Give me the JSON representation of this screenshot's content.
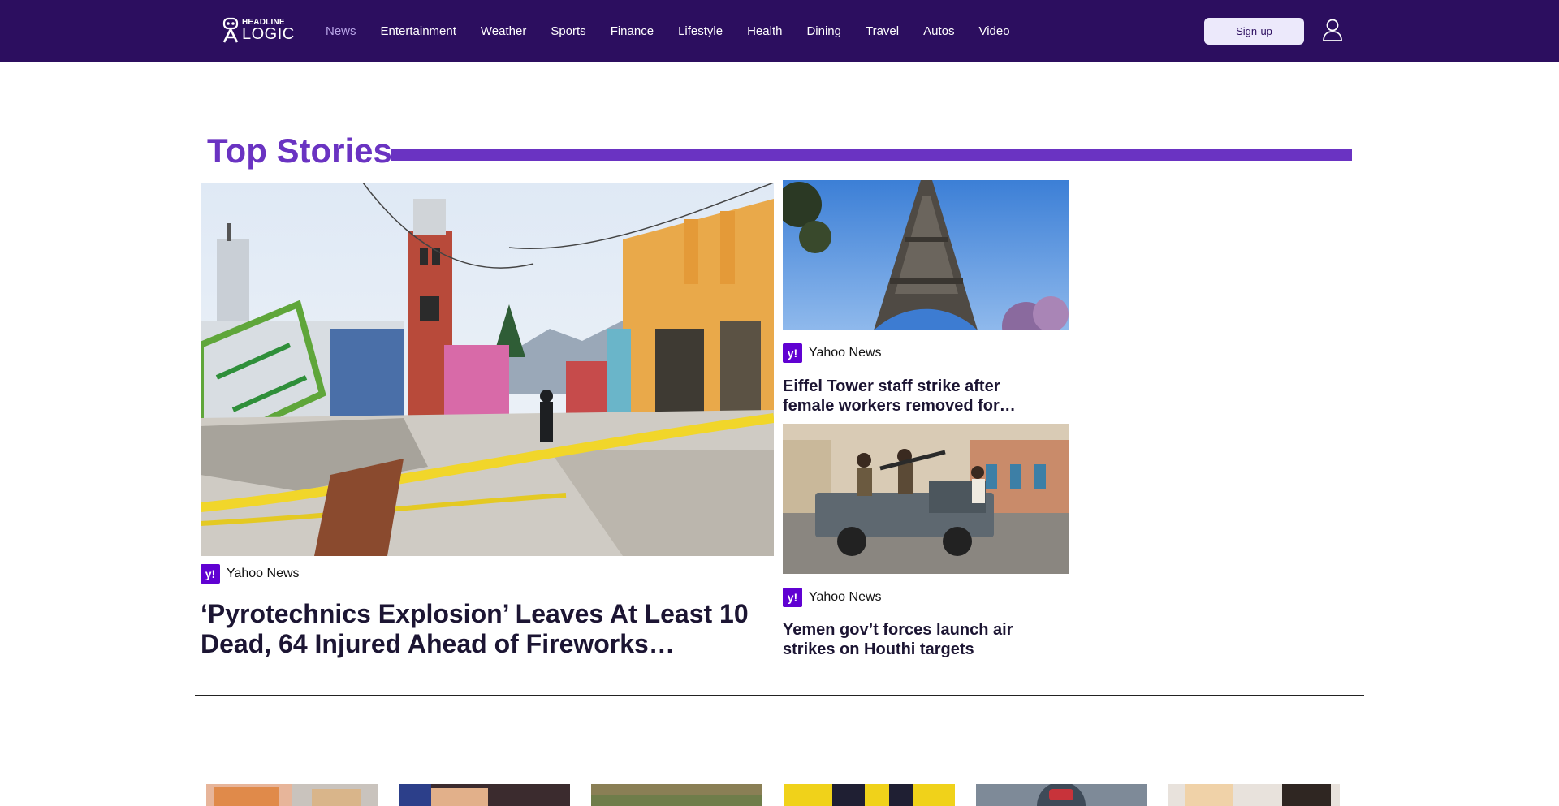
{
  "header": {
    "logo_top": "HEADLINE",
    "logo_bottom": "LOGIC",
    "nav": [
      {
        "label": "News",
        "active": true
      },
      {
        "label": "Entertainment"
      },
      {
        "label": "Weather"
      },
      {
        "label": "Sports"
      },
      {
        "label": "Finance"
      },
      {
        "label": "Lifestyle"
      },
      {
        "label": "Health"
      },
      {
        "label": "Dining"
      },
      {
        "label": "Travel"
      },
      {
        "label": "Autos"
      },
      {
        "label": "Video"
      }
    ],
    "signup_label": "Sign-up",
    "colors": {
      "bar": "#2c0e5f",
      "active": "#b9a6e8"
    }
  },
  "top_stories": {
    "title": "Top Stories",
    "accent": "#6a33c2",
    "hero": {
      "source": "Yahoo News",
      "headline": "‘Pyrotechnics Explosion’ Leaves At Least 10 Dead, 64 Injured Ahead of Fireworks…"
    },
    "side": [
      {
        "source": "Yahoo News",
        "headline": "Eiffel Tower staff strike after female workers removed for…"
      },
      {
        "source": "Yahoo News",
        "headline": "Yemen gov’t forces launch air strikes on Houthi targets"
      }
    ],
    "source_badge": "y!"
  }
}
